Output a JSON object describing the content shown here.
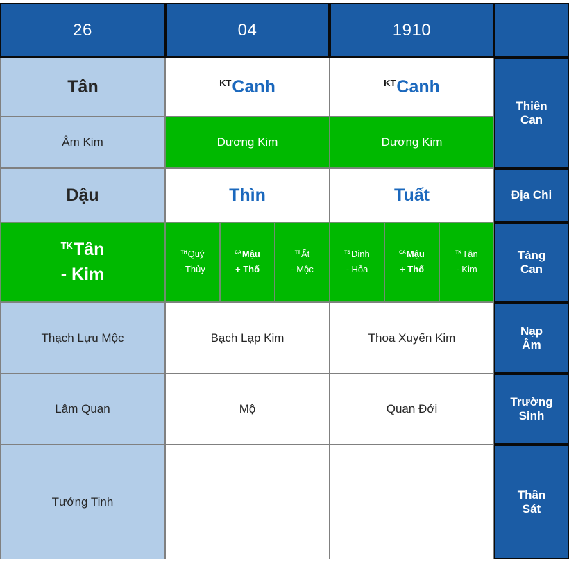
{
  "header": {
    "day": "26",
    "month": "04",
    "year": "1910",
    "corner": ""
  },
  "row_labels": {
    "thien_can": "Thiên\nCan",
    "thien_can_line1": "Thiên",
    "thien_can_line2": "Can",
    "dia_chi": "Địa Chi",
    "tang_can_line1": "Tàng",
    "tang_can_line2": "Can",
    "nap_am_line1": "Nạp",
    "nap_am_line2": "Âm",
    "truong_sinh_line1": "Trường",
    "truong_sinh_line2": "Sinh",
    "than_sat_line1": "Thần",
    "than_sat_line2": "Sát"
  },
  "thien_can": {
    "day": {
      "sup": "",
      "name": "Tân"
    },
    "month": {
      "sup": "KT",
      "name": "Canh"
    },
    "year": {
      "sup": "KT",
      "name": "Canh"
    }
  },
  "thien_can_element": {
    "day": "Âm Kim",
    "month": "Dương Kim",
    "year": "Dương Kim"
  },
  "dia_chi": {
    "day": "Dậu",
    "month": "Thìn",
    "year": "Tuất"
  },
  "tang_can": {
    "day": [
      {
        "sup": "TK",
        "stem": "Tân",
        "element": "- Kim",
        "bold": true
      }
    ],
    "month": [
      {
        "sup": "TH",
        "stem": "Quý",
        "element": "- Thủy",
        "bold": false
      },
      {
        "sup": "CA",
        "stem": "Mậu",
        "element": "+ Thổ",
        "bold": true
      },
      {
        "sup": "TT",
        "stem": "Ất",
        "element": "- Mộc",
        "bold": false
      }
    ],
    "year": [
      {
        "sup": "TS",
        "stem": "Đinh",
        "element": "- Hỏa",
        "bold": false
      },
      {
        "sup": "CA",
        "stem": "Mậu",
        "element": "+ Thổ",
        "bold": true
      },
      {
        "sup": "TK",
        "stem": "Tân",
        "element": "- Kim",
        "bold": false
      }
    ]
  },
  "nap_am": {
    "day": "Thạch Lựu Mộc",
    "month": "Bạch Lạp Kim",
    "year": "Thoa Xuyến Kim"
  },
  "truong_sinh": {
    "day": "Lâm Quan",
    "month": "Mộ",
    "year": "Quan Đới"
  },
  "than_sat": {
    "day": "Tướng Tinh",
    "month": "",
    "year": ""
  },
  "colors": {
    "header_blue": "#1b5ca5",
    "light_blue": "#b3cde8",
    "green": "#00b900",
    "text_blue": "#1b68bd",
    "white": "#ffffff"
  }
}
